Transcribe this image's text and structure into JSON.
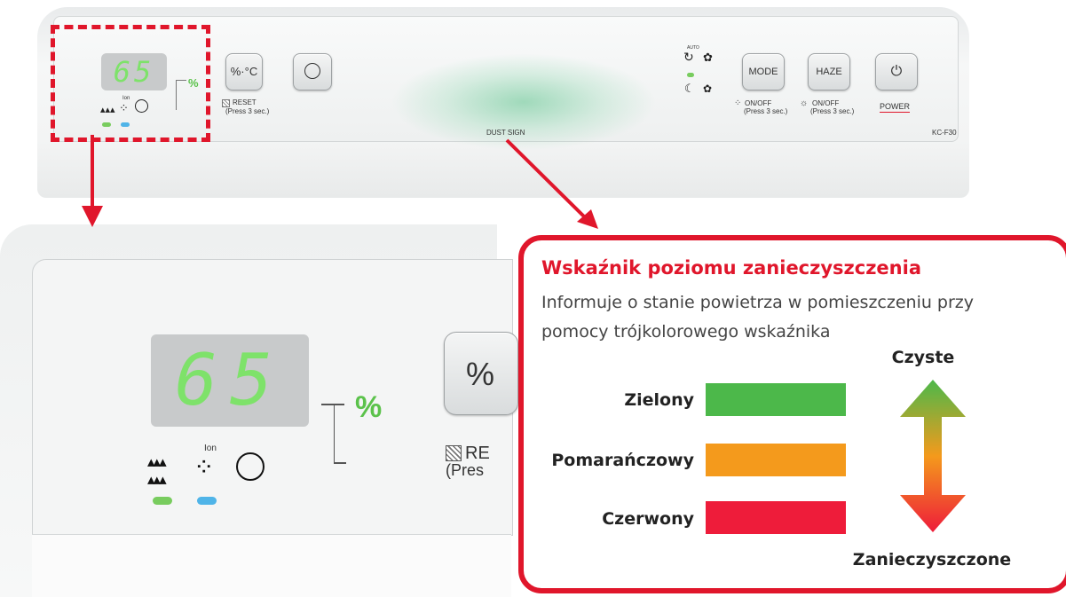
{
  "device": {
    "display_value": "65",
    "percent_symbol": "%",
    "temp_button_label": "%·°C",
    "reset_label": "RESET",
    "reset_hint": "(Press 3 sec.)",
    "auto_label": "AUTO",
    "mode_button_label": "MODE",
    "haze_button_label": "HAZE",
    "ion_on_off_label": "ON/OFF",
    "ion_on_off_hint": "(Press 3 sec.)",
    "haze_on_off_label": "ON/OFF",
    "haze_on_off_hint": "(Press 3 sec.)",
    "power_label": "POWER",
    "dust_sign_label": "DUST SIGN",
    "model_label": "KC-F30",
    "ion_label": "Ion"
  },
  "zoom": {
    "display_value": "65",
    "percent_symbol": "%",
    "reset_fragment": "RE",
    "press_fragment": "(Pres",
    "button_fragment": "%",
    "ion_label": "Ion"
  },
  "info": {
    "title": "Wskaźnik poziomu zanieczyszczenia",
    "description_line1": "Informuje o stanie powietrza w pomieszczeniu przy",
    "description_line2": "pomocy trójkolorowego wskaźnika",
    "clean_label": "Czyste",
    "dirty_label": "Zanieczyszczone",
    "levels": [
      {
        "label": "Zielony",
        "color": "#4cb84a"
      },
      {
        "label": "Pomarańczowy",
        "color": "#f49a1c"
      },
      {
        "label": "Czerwony",
        "color": "#ee1c3a"
      }
    ]
  },
  "colors": {
    "accent_red": "#e0162b",
    "lcd_green": "#7ee26a",
    "led_green": "#78cc5e",
    "led_blue": "#4fb4e8",
    "arrow_top": "#4cb84a",
    "arrow_bottom": "#ee1c3a"
  }
}
